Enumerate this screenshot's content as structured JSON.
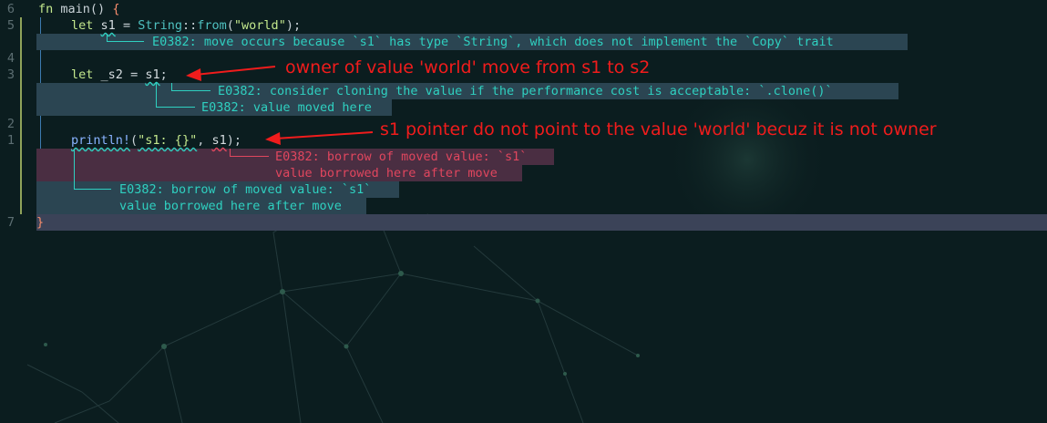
{
  "editor": {
    "line_numbers": [
      "6",
      "5",
      "4",
      "3",
      "2",
      "1",
      "7"
    ],
    "code": {
      "fn_kw": "fn",
      "fn_name": "main",
      "fn_parens": "()",
      "open_brace": "{",
      "let1_kw": "let",
      "let1_var": "s1",
      "let1_eq": "=",
      "let1_type": "String",
      "let1_sep": "::",
      "let1_call": "from",
      "let1_lp": "(",
      "let1_str": "\"world\"",
      "let1_rp": ");",
      "let2_kw": "let",
      "let2_var": "_s2",
      "let2_eq": "=",
      "let2_rhs": "s1",
      "let2_semi": ";",
      "print_macro": "println!",
      "print_lp": "(",
      "print_str": "\"s1: {}\"",
      "print_comma": ",",
      "print_arg": "s1",
      "print_rp": ");",
      "close_brace": "}"
    },
    "diagnostics": {
      "d1": "E0382: move occurs because `s1` has type `String`, which does not implement the `Copy` trait",
      "d2": "E0382: consider cloning the value if the performance cost is acceptable: `.clone()`",
      "d3": "E0382: value moved here",
      "d4a": "E0382: borrow of moved value: `s1`",
      "d4b": "value borrowed here after move",
      "d5a": "E0382: borrow of moved value: `s1`",
      "d5b": "value borrowed here after move"
    }
  },
  "annotations": {
    "a1": "owner of value 'world' move from s1 to s2",
    "a2": "s1 pointer do not point to the value 'world' becuz it is not owner"
  },
  "colors": {
    "background": "#0b1d1f",
    "diagnostic_teal": "#2fd0c0",
    "diagnostic_red": "#e0465e",
    "annotation_red": "#f01c1c"
  }
}
